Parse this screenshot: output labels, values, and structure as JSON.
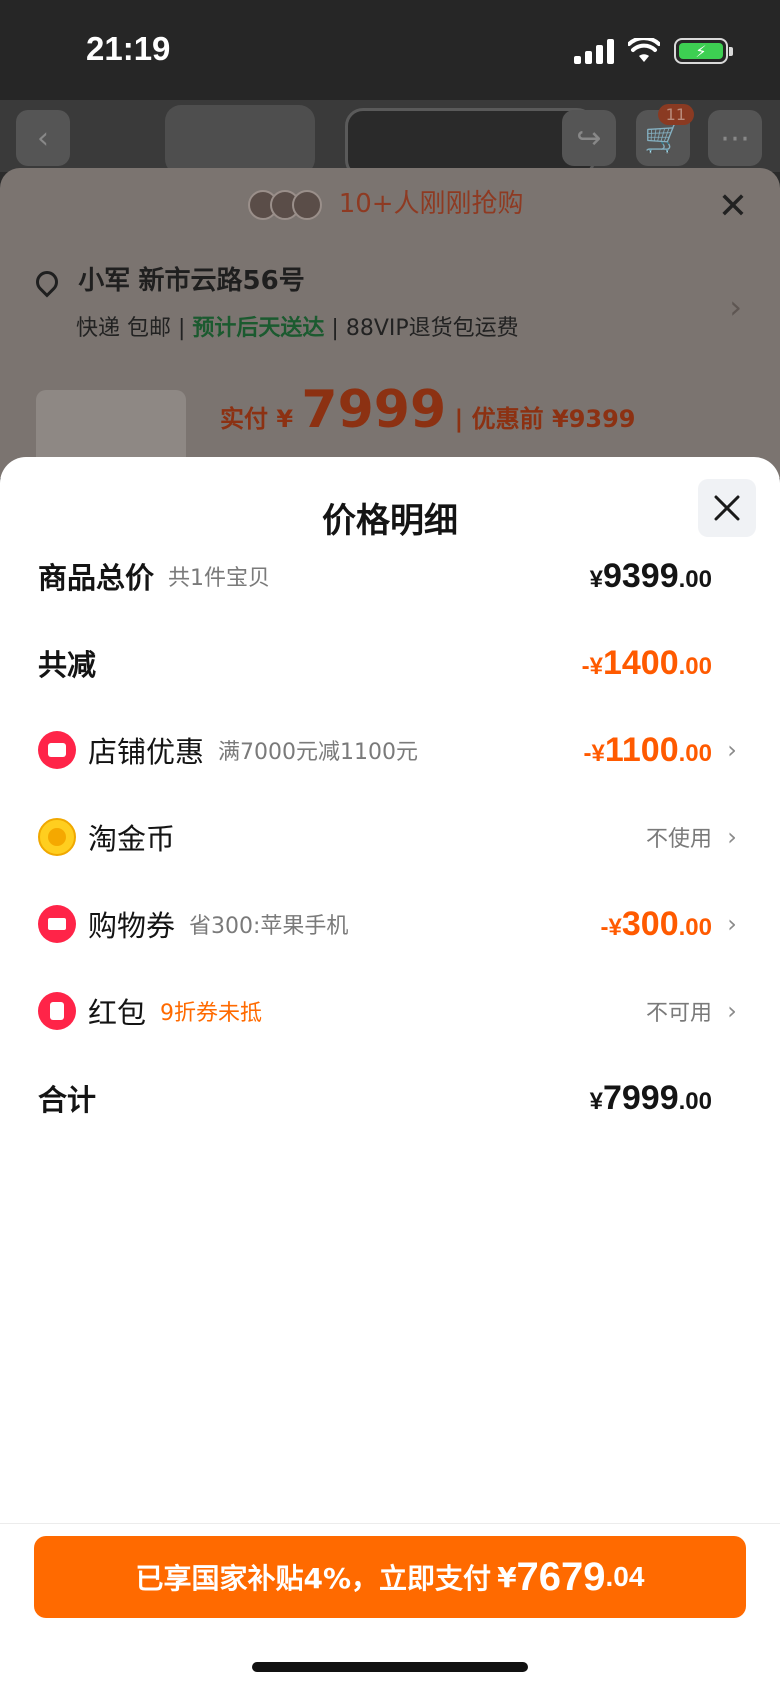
{
  "status_bar": {
    "time": "21:19"
  },
  "background_page": {
    "cart_count": "11",
    "banner_text": "10+人刚刚抢购",
    "address_name": "小军",
    "address": "新市云路56号",
    "delivery_method": "快递 包邮",
    "delivery_eta": "预计后天送达",
    "return_note": "88VIP退货包运费",
    "paid_label": "实付 ¥",
    "paid_amount": "7999",
    "before_discount": "优惠前 ¥9399"
  },
  "modal": {
    "title": "价格明细",
    "rows": {
      "total": {
        "label": "商品总价",
        "note": "共1件宝贝",
        "sym": "¥",
        "int": "9399",
        "dec": ".00"
      },
      "reduced": {
        "label": "共减",
        "sym": "-¥",
        "int": "1400",
        "dec": ".00"
      },
      "store": {
        "label": "店铺优惠",
        "note": "满7000元减1100元",
        "sym": "-¥",
        "int": "1100",
        "dec": ".00"
      },
      "coins": {
        "label": "淘金币",
        "value": "不使用"
      },
      "coupon": {
        "label": "购物券",
        "note": "省300:苹果手机",
        "sym": "-¥",
        "int": "300",
        "dec": ".00"
      },
      "redpacket": {
        "label": "红包",
        "note": "9折券未抵",
        "value": "不可用"
      },
      "sum": {
        "label": "合计",
        "sym": "¥",
        "int": "7999",
        "dec": ".00"
      }
    }
  },
  "pay": {
    "lead": "已享国家补贴4%，立即支付",
    "sym": "¥",
    "int": "7679",
    "dec": ".04",
    "color": "#ff6a00"
  },
  "colors": {
    "accent_orange": "#ff5a00",
    "icon_red": "#ff2448",
    "icon_gold": "#ffce1f"
  }
}
